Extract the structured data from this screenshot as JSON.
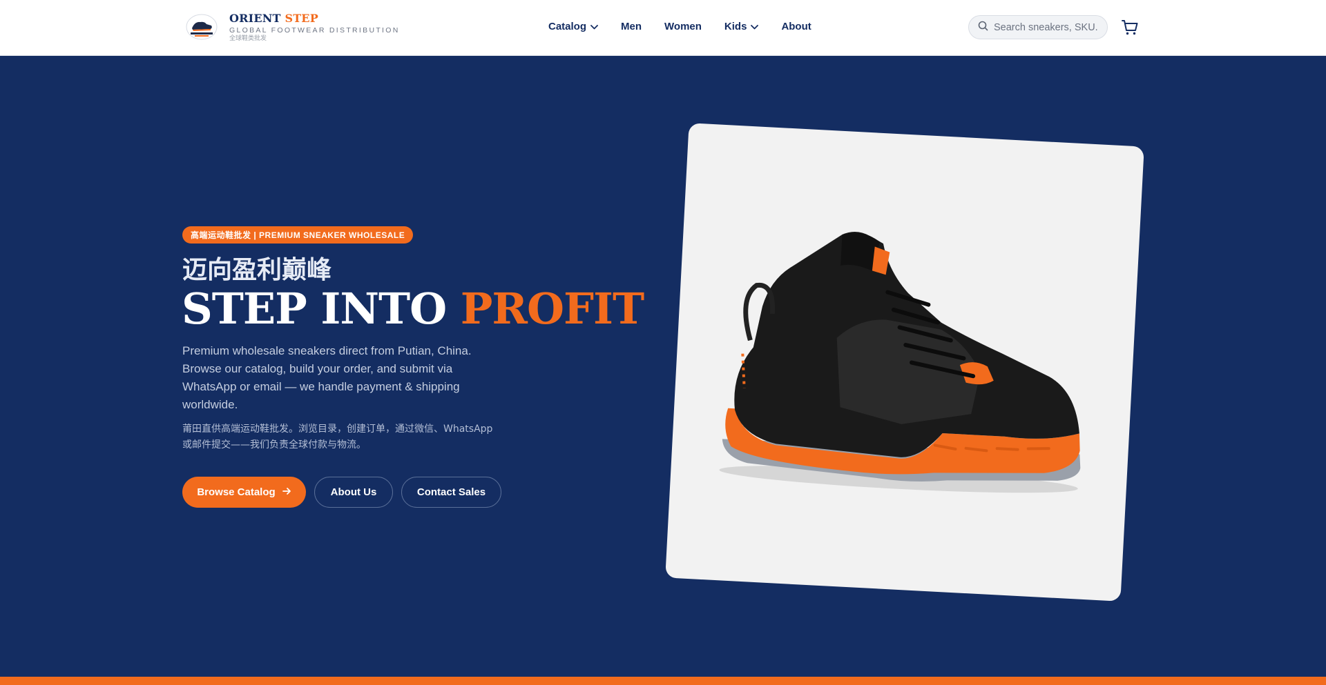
{
  "colors": {
    "navy": "#142d62",
    "accent_orange": "#f26b1d",
    "white": "#ffffff",
    "card_bg": "#f2f2f2"
  },
  "header": {
    "brand_name_primary": "ORIENT",
    "brand_name_accent": "STEP",
    "tagline": "GLOBAL FOOTWEAR DISTRIBUTION",
    "tagline_cn": "全球鞋类批发",
    "logo_icon": "orient-step-logo",
    "nav": [
      {
        "label": "Catalog",
        "has_dropdown": true
      },
      {
        "label": "Men",
        "has_dropdown": false
      },
      {
        "label": "Women",
        "has_dropdown": false
      },
      {
        "label": "Kids",
        "has_dropdown": true
      },
      {
        "label": "About",
        "has_dropdown": false
      }
    ],
    "search_placeholder": "Search sneakers, SKU...",
    "search_icon": "search-icon",
    "cart_icon": "cart-icon"
  },
  "hero": {
    "badge": "高端运动鞋批发 | PREMIUM SNEAKER WHOLESALE",
    "headline_cn": "迈向盈利巅峰",
    "headline_en_primary": "STEP INTO",
    "headline_en_accent": "PROFIT",
    "description": "Premium wholesale sneakers direct from Putian, China. Browse our catalog, build your order, and submit via WhatsApp or email — we handle payment & shipping worldwide.",
    "description_cn": "莆田直供高端运动鞋批发。浏览目录，创建订单，通过微信、WhatsApp或邮件提交——我们负责全球付款与物流。",
    "buttons": {
      "browse": "Browse Catalog",
      "about": "About Us",
      "contact": "Contact Sales"
    },
    "product_image": "basketball-sneaker-black-orange"
  }
}
